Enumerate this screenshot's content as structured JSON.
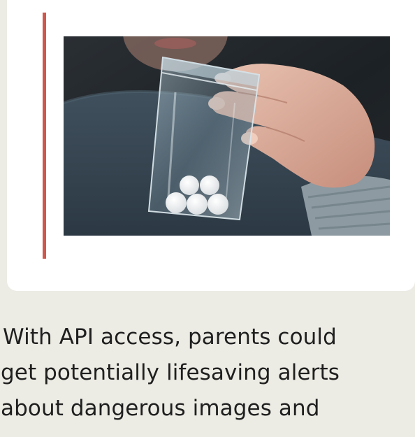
{
  "article": {
    "paragraph_lines": [
      "With API access, parents could",
      "get potentially lifesaving alerts",
      "about dangerous images and"
    ]
  },
  "colors": {
    "page_background": "#ecebe4",
    "card_background": "#ffffff",
    "accent_bar": "#d0574b",
    "text": "#1f1f1f"
  },
  "image": {
    "subject": "hand holding a clear plastic bag with white pills"
  }
}
